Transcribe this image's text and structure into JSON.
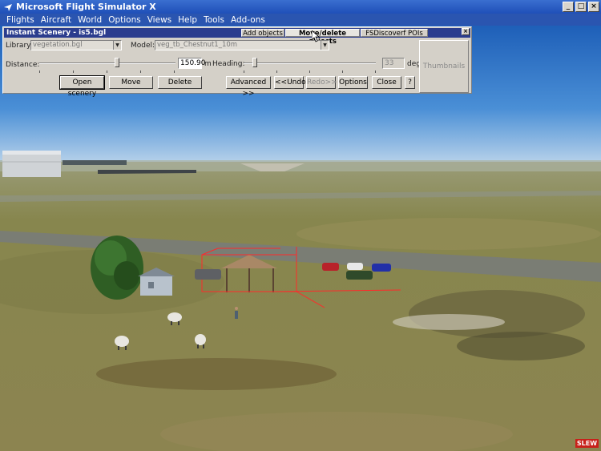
{
  "window": {
    "title": "Microsoft Flight Simulator X"
  },
  "menu": [
    "Flights",
    "Aircraft",
    "World",
    "Options",
    "Views",
    "Help",
    "Tools",
    "Add-ons"
  ],
  "dialog": {
    "title": "Instant Scenery - is5.bgl",
    "tabs": [
      "Add objects",
      "Move/delete objects",
      "FSDiscoverf POIs"
    ],
    "active_tab": "Move/delete objects",
    "library_label": "Library:",
    "library_value": "vegetation.bgl",
    "model_label": "Model:",
    "model_value": "veg_tb_Chestnut1_10m",
    "distance_label": "Distance:",
    "distance_value": "150.90",
    "distance_unit": "m",
    "heading_label": "Heading:",
    "heading_value": "33",
    "heading_unit": "deg",
    "buttons": {
      "open_scenery": "Open scenery",
      "move": "Move",
      "delete": "Delete",
      "advanced": "Advanced >>",
      "undo": "<<Undo",
      "redo": "Redo>>",
      "options": "Options",
      "close": "Close",
      "help": "?",
      "thumbnails": "Thumbnails"
    },
    "close_glyph": "×"
  },
  "titlebar_buttons": {
    "minimize": "_",
    "maximize": "□",
    "close": "×"
  },
  "status": {
    "slew": "SLEW"
  },
  "colors": {
    "sky": "#4a8fd6",
    "grass": "#8f8a52",
    "dialog": "#d4d0c8",
    "titlebar": "#2b3d8e",
    "slew": "#c8201a"
  }
}
